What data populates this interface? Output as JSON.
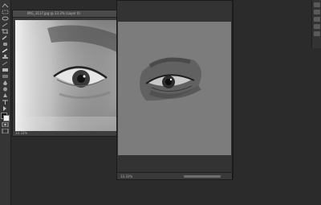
{
  "document1": {
    "title": "IMG_3117.jpg @ 33.3% (Layer 0)",
    "status": "33.33%"
  },
  "document2": {
    "status": "33.33%"
  },
  "tools": [
    "move-icon",
    "marquee-icon",
    "lasso-icon",
    "magic-wand-icon",
    "crop-icon",
    "eyedropper-icon",
    "healing-icon",
    "brush-icon",
    "clone-stamp-icon",
    "history-brush-icon",
    "eraser-icon",
    "gradient-icon",
    "blur-icon",
    "dodge-icon",
    "pen-icon",
    "type-icon",
    "path-select-icon",
    "shape-icon",
    "hand-icon",
    "zoom-icon"
  ]
}
